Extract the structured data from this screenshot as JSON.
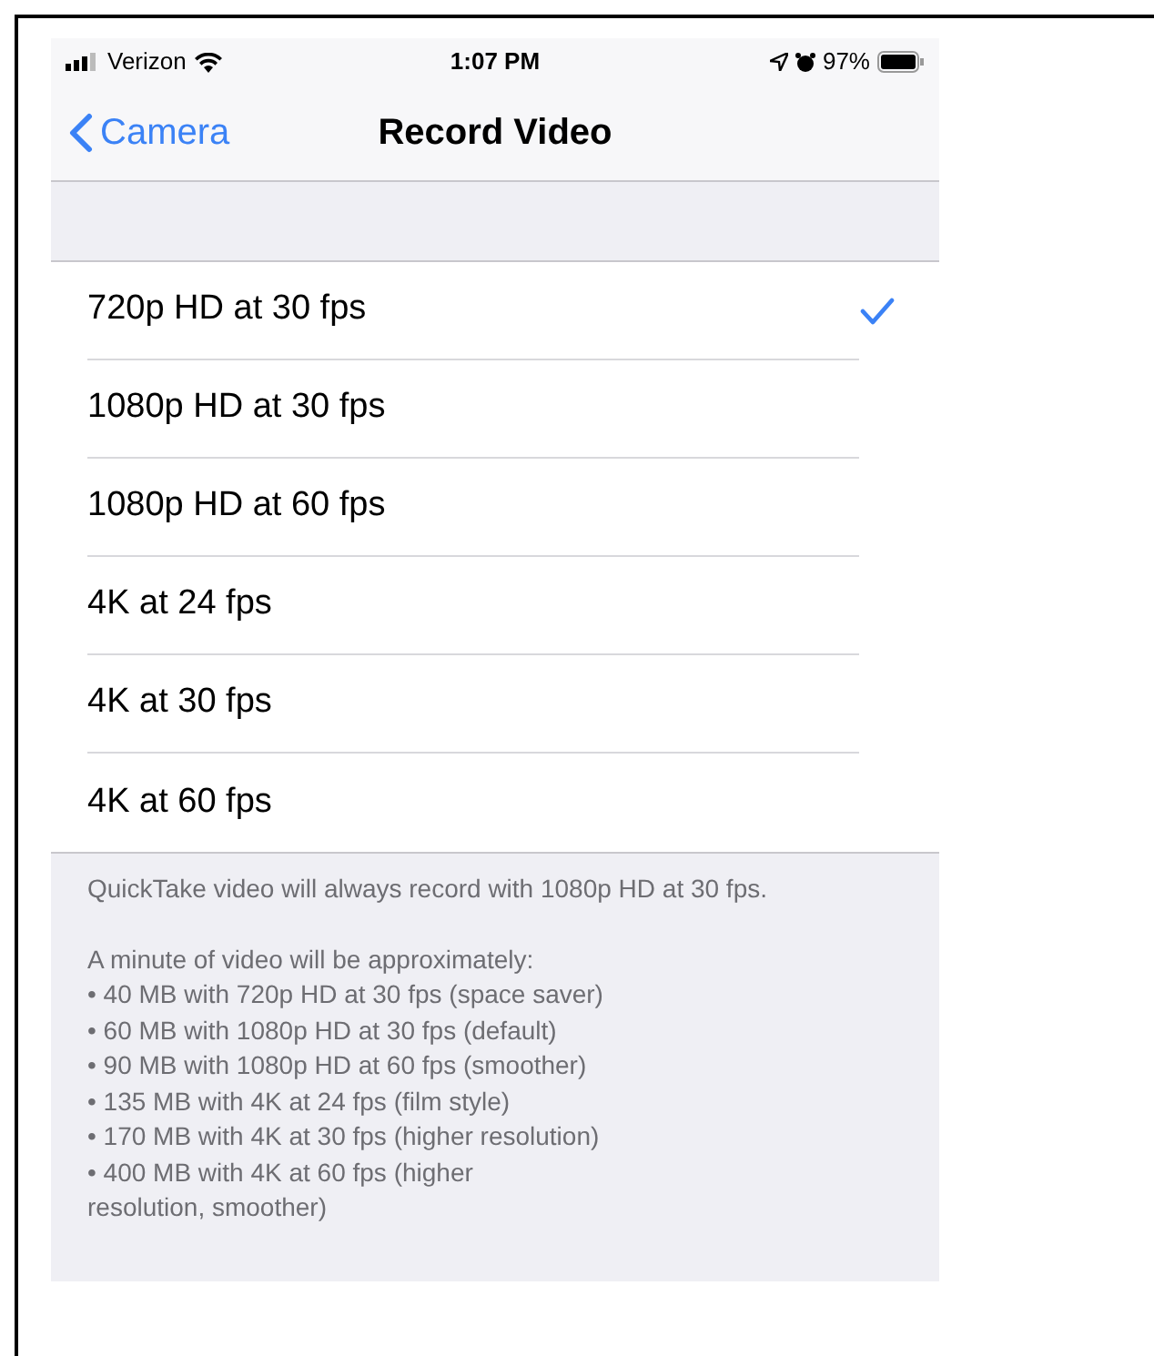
{
  "status_bar": {
    "carrier": "Verizon",
    "time": "1:07 PM",
    "battery": "97%"
  },
  "nav": {
    "back": "Camera",
    "title": "Record Video"
  },
  "options": [
    {
      "label": "720p HD at 30 fps",
      "selected": true
    },
    {
      "label": "1080p HD at 30 fps",
      "selected": false
    },
    {
      "label": "1080p HD at 60 fps",
      "selected": false
    },
    {
      "label": "4K at 24 fps",
      "selected": false
    },
    {
      "label": "4K at 30 fps",
      "selected": false
    },
    {
      "label": "4K at 60 fps",
      "selected": false
    }
  ],
  "footer": {
    "note": "QuickTake video will always record with 1080p HD at 30 fps.",
    "intro": "A minute of video will be approximately:",
    "bullets": [
      "• 40 MB with 720p HD at 30 fps (space saver)",
      "• 60 MB with 1080p HD at 30 fps (default)",
      "• 90 MB with 1080p HD at 60 fps (smoother)",
      "• 135 MB with 4K at 24 fps (film style)",
      "• 170 MB with 4K at 30 fps (higher resolution)",
      "• 400 MB with 4K at 60 fps (higher resolution, smoother)"
    ]
  }
}
